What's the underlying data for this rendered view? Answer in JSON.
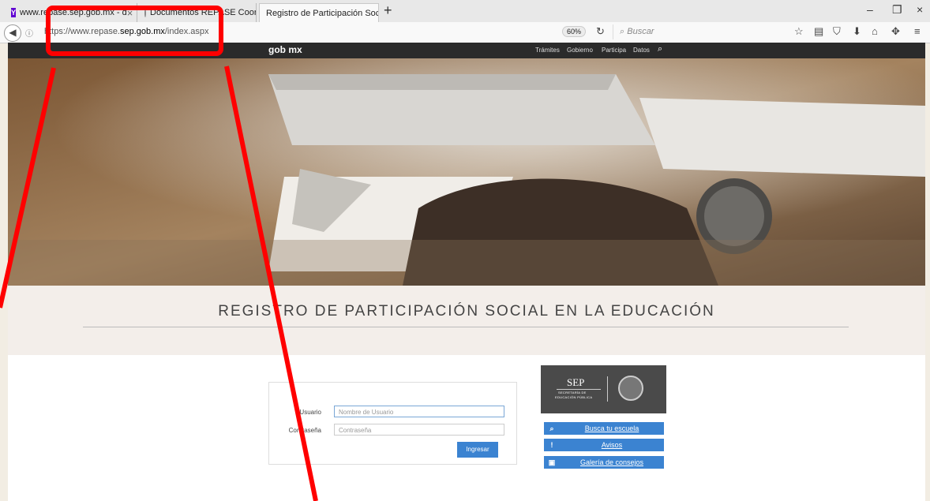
{
  "browser": {
    "tabs": [
      {
        "label": "www.repase.sep.gob.mx - d",
        "favicon": "yahoo-y-icon"
      },
      {
        "label": "Documentos REPASE Coor",
        "favicon": "drive-icon"
      },
      {
        "label": "Registro de Participación Social"
      }
    ],
    "url_prefix": "https://www.repase.",
    "url_domain": "sep.gob.mx",
    "url_path": "/index.aspx",
    "zoom": "60%",
    "search_placeholder": "Buscar"
  },
  "gobbar": {
    "logo": "gob mx",
    "nav": [
      "Trámites",
      "Gobierno",
      "Participa",
      "Datos"
    ]
  },
  "page": {
    "title": "REGISTRO DE PARTICIPACIÓN SOCIAL EN LA EDUCACIÓN"
  },
  "login": {
    "user_label": "Usuario",
    "user_placeholder": "Nombre de Usuario",
    "pass_label": "Contraseña",
    "pass_placeholder": "Contraseña",
    "submit": "Ingresar"
  },
  "sep_logo": {
    "name": "SEP",
    "subtitle_line1": "SECRETARÍA DE",
    "subtitle_line2": "EDUCACIÓN PÚBLICA"
  },
  "side_links": [
    {
      "label": "Busca tu escuela",
      "icon": "search-icon"
    },
    {
      "label": "Avisos",
      "icon": "exclamation-icon"
    },
    {
      "label": "Galería de consejos",
      "icon": "image-icon"
    }
  ],
  "colors": {
    "accent": "#3b83d1",
    "annotation": "#ff0000",
    "gobbar": "#2b2b2b"
  }
}
